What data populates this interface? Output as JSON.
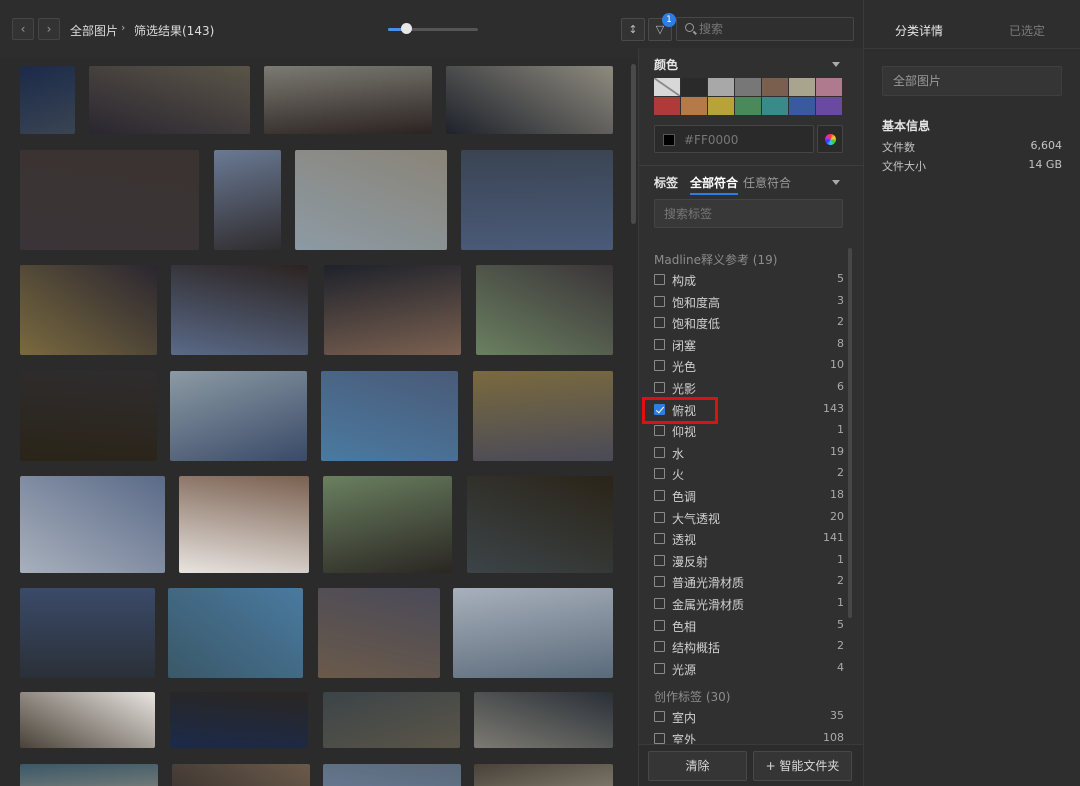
{
  "topbar": {
    "back_glyph": "‹",
    "forward_glyph": "›",
    "breadcrumb_root": "全部图片",
    "breadcrumb_sep": "›",
    "breadcrumb_current": "筛选结果(143)",
    "zoom_level": 0.2,
    "sort_glyph": "↕",
    "filter_glyph": "▽",
    "filter_badge": "1",
    "search_placeholder": "搜索"
  },
  "gallery": {
    "thumbnail_count_visible": 38,
    "palette": [
      "#1b2a4a",
      "#5a5548",
      "#7c7a72",
      "#8e8a7e",
      "#3a3330",
      "#6a7a94",
      "#8a8478",
      "#3a4452",
      "#2a2630",
      "#2b2321",
      "#1e222b",
      "#3a3438",
      "#2f2c2e",
      "#8c9aa4",
      "#4a5a78",
      "#7a6a3e",
      "#5a6a88",
      "#7a6050",
      "#6a8060",
      "#2a2418",
      "#3a4a68",
      "#4a7aa0",
      "#4a4a58",
      "#a8b0bc",
      "#e8e4e0",
      "#2a2622",
      "#3c4448",
      "#2a3038",
      "#3a5868",
      "#6a5a4a",
      "#5a6a7a",
      "#4a4238"
    ]
  },
  "filter": {
    "color_title": "颜色",
    "swatches": [
      "none",
      "#2a2a2a",
      "#a8a8a8",
      "#777777",
      "#7a5f4e",
      "#a8a48e",
      "#b07a8e",
      "#b03a3a",
      "#b47a4a",
      "#b8a23a",
      "#4a8a5a",
      "#3a8a8a",
      "#3a5aa0",
      "#6a4aa0"
    ],
    "hex_placeholder": "#FF0000",
    "tag_title": "标签",
    "tab_all": "全部符合",
    "tab_any": "任意符合",
    "tag_search_placeholder": "搜索标签",
    "group1": {
      "title": "Madline释义参考 (19)",
      "items": [
        {
          "label": "构成",
          "count": "5",
          "checked": false
        },
        {
          "label": "饱和度高",
          "count": "3",
          "checked": false
        },
        {
          "label": "饱和度低",
          "count": "2",
          "checked": false
        },
        {
          "label": "闭塞",
          "count": "8",
          "checked": false
        },
        {
          "label": "光色",
          "count": "10",
          "checked": false
        },
        {
          "label": "光影",
          "count": "6",
          "checked": false
        },
        {
          "label": "俯视",
          "count": "143",
          "checked": true
        },
        {
          "label": "仰视",
          "count": "1",
          "checked": false
        },
        {
          "label": "水",
          "count": "19",
          "checked": false
        },
        {
          "label": "火",
          "count": "2",
          "checked": false
        },
        {
          "label": "色调",
          "count": "18",
          "checked": false
        },
        {
          "label": "大气透视",
          "count": "20",
          "checked": false
        },
        {
          "label": "透视",
          "count": "141",
          "checked": false
        },
        {
          "label": "漫反射",
          "count": "1",
          "checked": false
        },
        {
          "label": "普通光滑材质",
          "count": "2",
          "checked": false
        },
        {
          "label": "金属光滑材质",
          "count": "1",
          "checked": false
        },
        {
          "label": "色相",
          "count": "5",
          "checked": false
        },
        {
          "label": "结构概括",
          "count": "2",
          "checked": false
        },
        {
          "label": "光源",
          "count": "4",
          "checked": false
        }
      ]
    },
    "group2": {
      "title": "创作标签 (30)",
      "items": [
        {
          "label": "室内",
          "count": "35",
          "checked": false
        },
        {
          "label": "室外",
          "count": "108",
          "checked": false
        }
      ]
    },
    "clear_label": "清除",
    "smart_folder_label": "+ 智能文件夹"
  },
  "right": {
    "tab_details": "分类详情",
    "tab_selected": "已选定",
    "folder": "全部图片",
    "info_title": "基本信息",
    "file_count_label": "文件数",
    "file_count": "6,604",
    "file_size_label": "文件大小",
    "file_size": "14 GB"
  }
}
